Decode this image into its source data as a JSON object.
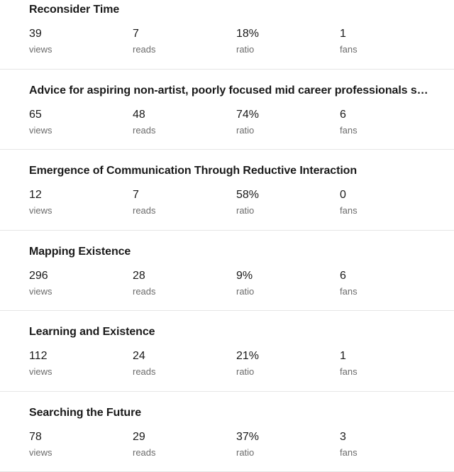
{
  "stat_labels": {
    "views": "views",
    "reads": "reads",
    "ratio": "ratio",
    "fans": "fans"
  },
  "stories": [
    {
      "title": "Reconsider Time",
      "views": "39",
      "reads": "7",
      "ratio": "18%",
      "fans": "1"
    },
    {
      "title": "Advice for aspiring non-artist, poorly focused mid career professionals seekin…",
      "views": "65",
      "reads": "48",
      "ratio": "74%",
      "fans": "6"
    },
    {
      "title": "Emergence of Communication Through Reductive Interaction",
      "views": "12",
      "reads": "7",
      "ratio": "58%",
      "fans": "0"
    },
    {
      "title": "Mapping Existence",
      "views": "296",
      "reads": "28",
      "ratio": "9%",
      "fans": "6"
    },
    {
      "title": "Learning and Existence",
      "views": "112",
      "reads": "24",
      "ratio": "21%",
      "fans": "1"
    },
    {
      "title": "Searching the Future",
      "views": "78",
      "reads": "29",
      "ratio": "37%",
      "fans": "3"
    }
  ],
  "colors": {
    "text": "#1a1a1a",
    "muted": "#6b6b6b",
    "divider": "#e6e6e6"
  }
}
